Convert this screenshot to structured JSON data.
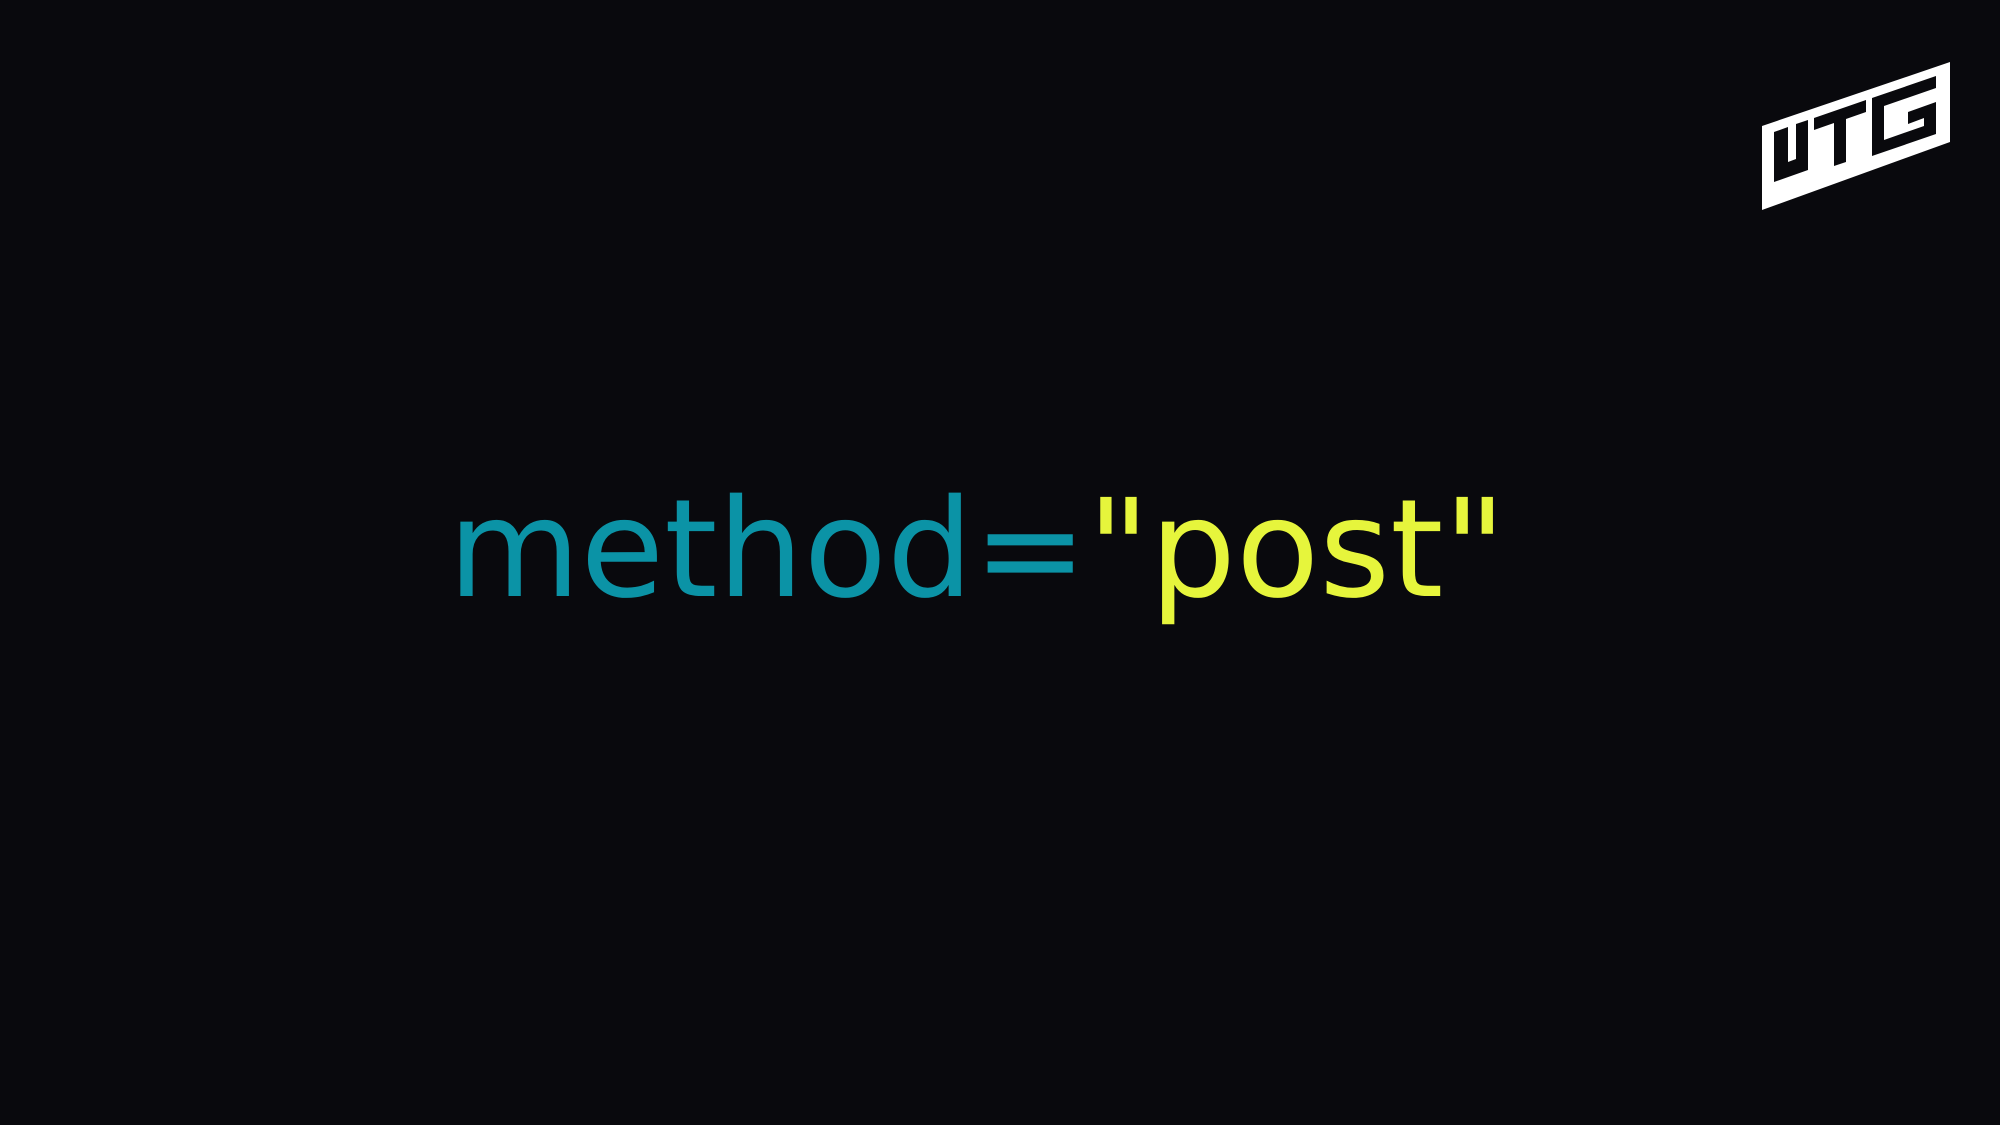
{
  "logo": {
    "icon": "htc-logo-icon",
    "text": "HTG",
    "color": "#ffffff"
  },
  "code": {
    "attribute": "method",
    "equals": "=",
    "value": "\"post\""
  },
  "colors": {
    "background": "#09090d",
    "attribute": "#0b93a6",
    "value": "#e6f53c"
  }
}
